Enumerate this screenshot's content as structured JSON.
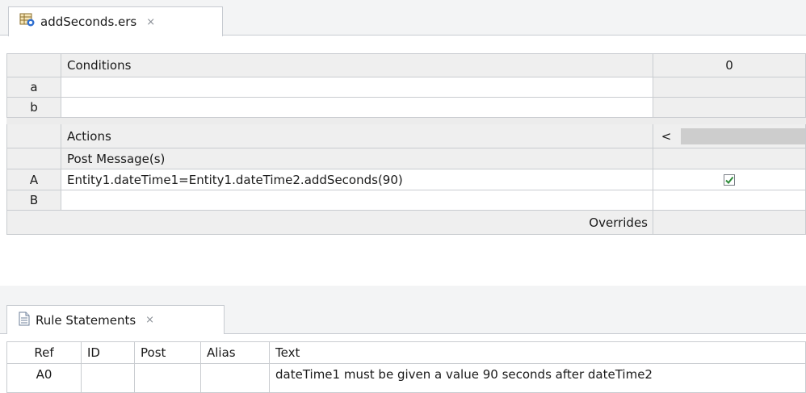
{
  "editor": {
    "tab": {
      "icon": "rulesheet-icon",
      "label": "addSeconds.ers",
      "close_symbol": "⨯"
    },
    "conditions": {
      "header": "Conditions",
      "column_label": "0",
      "rows": [
        {
          "id": "a",
          "value": ""
        },
        {
          "id": "b",
          "value": ""
        }
      ]
    },
    "actions": {
      "header": "Actions",
      "scroll_left_symbol": "<",
      "post_message_label": "Post Message(s)",
      "rows": [
        {
          "id": "A",
          "value": "Entity1.dateTime1=Entity1.dateTime2.addSeconds(90)",
          "checked": true
        },
        {
          "id": "B",
          "value": "",
          "checked": false
        }
      ],
      "overrides_label": "Overrides"
    }
  },
  "rule_statements": {
    "tab": {
      "icon": "document-icon",
      "label": "Rule Statements",
      "close_symbol": "⨯"
    },
    "columns": [
      "Ref",
      "ID",
      "Post",
      "Alias",
      "Text"
    ],
    "rows": [
      {
        "ref": "A0",
        "id": "",
        "post": "",
        "alias": "",
        "text": "dateTime1 must be given a value 90 seconds after dateTime2"
      }
    ]
  },
  "colors": {
    "check": "#2e8b3a",
    "grey_cell": "#efefef",
    "grid": "#c9ccd0"
  }
}
